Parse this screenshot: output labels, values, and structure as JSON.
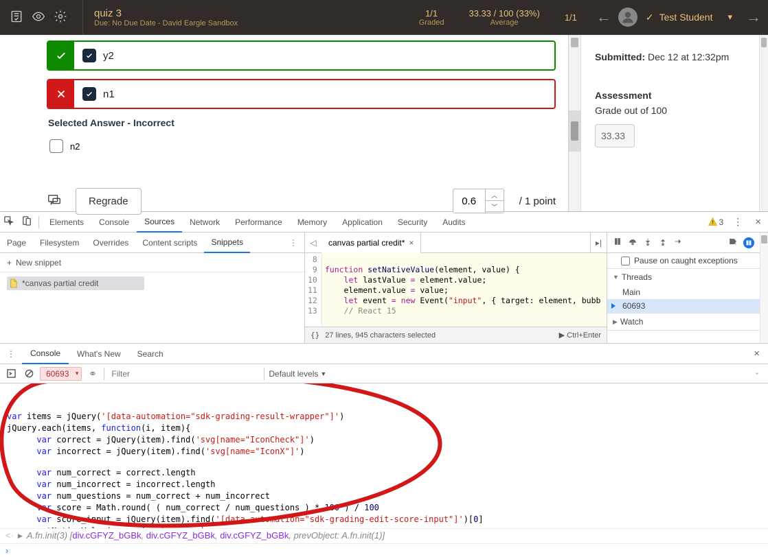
{
  "topbar": {
    "title": "quiz 3",
    "subtitle": "Due: No Due Date - David Eargle Sandbox",
    "graded": {
      "value": "1/1",
      "label": "Graded"
    },
    "average": {
      "value": "33.33 / 100 (33%)",
      "label": "Average"
    },
    "count": "1/1",
    "student": "Test Student"
  },
  "answers": {
    "correct_label": "y2",
    "incorrect_label": "n1",
    "selected_heading": "Selected Answer - Incorrect",
    "unselected_label": "n2"
  },
  "score": {
    "regrade": "Regrade",
    "value": "0.6",
    "points_label": "/ 1 point"
  },
  "sidebar": {
    "submitted_label": "Submitted:",
    "submitted_value": " Dec 12 at 12:32pm",
    "assessment_heading": "Assessment",
    "grade_label": "Grade out of 100",
    "grade_value": "33.33"
  },
  "devtools": {
    "tabs": [
      "Elements",
      "Console",
      "Sources",
      "Network",
      "Performance",
      "Memory",
      "Application",
      "Security",
      "Audits"
    ],
    "active_tab": "Sources",
    "warn_count": "3",
    "sources_tabs": [
      "Page",
      "Filesystem",
      "Overrides",
      "Content scripts",
      "Snippets"
    ],
    "sources_active": "Snippets",
    "new_snippet": "New snippet",
    "snippet_file": "*canvas partial credit",
    "editor_tab": "canvas partial credit*",
    "editor_footer": "27 lines, 945 characters selected",
    "editor_run": "Ctrl+Enter",
    "pause_label": "Pause on caught exceptions",
    "threads_label": "Threads",
    "thread_main": "Main",
    "thread_worker": "60693",
    "watch_label": "Watch",
    "gutter": [
      "8",
      "9",
      "10",
      "11",
      "12",
      "13"
    ],
    "code": {
      "l1a": "function",
      "l1b": " setNativeValue",
      "l1c": "(element, value) {",
      "l2a": "    let",
      "l2b": " lastValue ",
      "l2c": "=",
      "l2d": " element.value;",
      "l3a": "    element.value ",
      "l3b": "=",
      "l3c": " value;",
      "l4a": "    let",
      "l4b": " event ",
      "l4c": "= new",
      "l4d": " Event(",
      "l4e": "\"input\"",
      "l4f": ", { target: element, bubb",
      "l5": "    // React 15",
      "l6": " "
    }
  },
  "drawer": {
    "tabs": [
      "Console",
      "What's New",
      "Search"
    ],
    "active": "Console",
    "context": "60693",
    "filter_placeholder": "Filter",
    "levels": "Default levels",
    "console_lines": {
      "l1": "var items = jQuery('[data-automation=\"sdk-grading-result-wrapper\"]')",
      "l2": "jQuery.each(items, function(i, item){",
      "l3": "      var correct = jQuery(item).find('svg[name=\"IconCheck\"]')",
      "l4": "      var incorrect = jQuery(item).find('svg[name=\"IconX\"]')",
      "l5": "      var num_correct = correct.length",
      "l6": "      var num_incorrect = incorrect.length",
      "l7": "      var num_questions = num_correct + num_incorrect",
      "l8": "      var score = Math.round( ( num_correct / num_questions ) * 100 ) / 100",
      "l9a": "      var score_input = jQuery(item).find('[data-automation=\"sdk-grading-edit-score-input\"]')",
      "l9b": "[0]",
      "l10": "      setNativeValue(score_input, score)"
    },
    "return_line": "A.fn.init(3) [div.cGFYZ_bGBk, div.cGFYZ_bGBk, div.cGFYZ_bGBk, prevObject: A.fn.init(1)]"
  }
}
